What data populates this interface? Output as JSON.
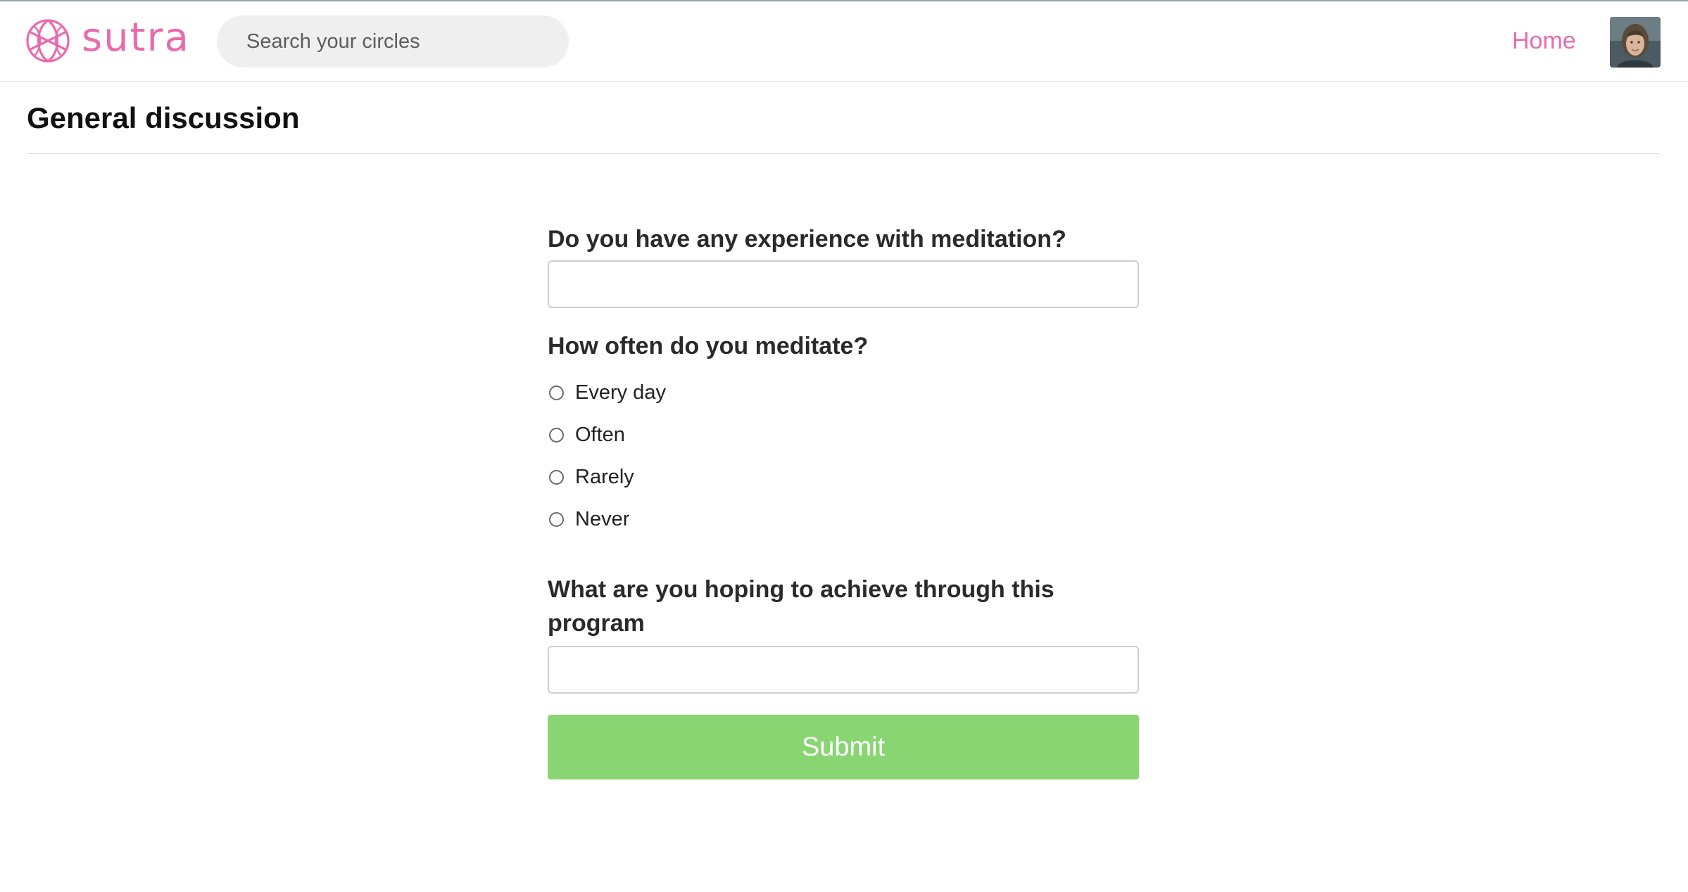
{
  "app": {
    "brand": "sutra",
    "colors": {
      "brand": "#ea6aae",
      "submit": "#88d572"
    }
  },
  "header": {
    "search": {
      "placeholder": "Search your circles",
      "value": ""
    },
    "nav": {
      "home_label": "Home"
    },
    "avatar_icon": "user-avatar"
  },
  "page": {
    "title": "General discussion"
  },
  "form": {
    "q1": {
      "label": "Do you have any experience with meditation?",
      "value": ""
    },
    "q2": {
      "label": "How often do you meditate?",
      "options": [
        "Every day",
        "Often",
        "Rarely",
        "Never"
      ],
      "selected": null
    },
    "q3": {
      "label": "What are you hoping to achieve through this program",
      "value": ""
    },
    "submit_label": "Submit"
  }
}
